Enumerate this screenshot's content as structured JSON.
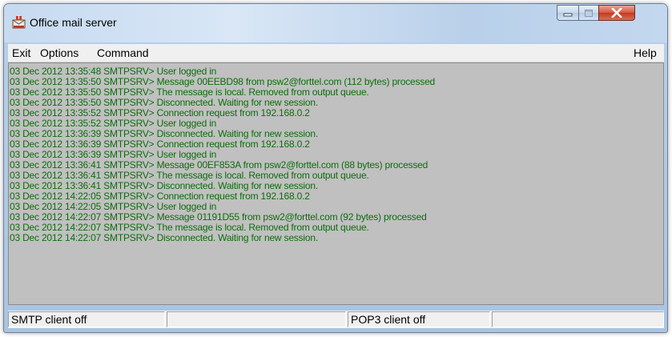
{
  "window": {
    "title": "Office mail server"
  },
  "menu": {
    "exit": "Exit",
    "options": "Options",
    "command": "Command",
    "help": "Help"
  },
  "log": [
    "03 Dec 2012 13:35:48 SMTPSRV> User  logged in",
    "03 Dec 2012 13:35:50 SMTPSRV> Message 00EEBD98 from psw2@forttel.com (112 bytes) processed",
    "03 Dec 2012 13:35:50 SMTPSRV> The message is local. Removed from output queue.",
    "03 Dec 2012 13:35:50 SMTPSRV> Disconnected. Waiting for new session.",
    "03 Dec 2012 13:35:52 SMTPSRV> Connection request from 192.168.0.2",
    "03 Dec 2012 13:35:52 SMTPSRV> User  logged in",
    "03 Dec 2012 13:36:39 SMTPSRV> Disconnected. Waiting for new session.",
    "03 Dec 2012 13:36:39 SMTPSRV> Connection request from 192.168.0.2",
    "03 Dec 2012 13:36:39 SMTPSRV> User  logged in",
    "03 Dec 2012 13:36:41 SMTPSRV> Message 00EF853A from psw2@forttel.com (88 bytes) processed",
    "03 Dec 2012 13:36:41 SMTPSRV> The message is local. Removed from output queue.",
    "03 Dec 2012 13:36:41 SMTPSRV> Disconnected. Waiting for new session.",
    "03 Dec 2012 14:22:05 SMTPSRV> Connection request from 192.168.0.2",
    "03 Dec 2012 14:22:05 SMTPSRV> User  logged in",
    "03 Dec 2012 14:22:07 SMTPSRV> Message 01191D55 from psw2@forttel.com (92 bytes) processed",
    "03 Dec 2012 14:22:07 SMTPSRV> The message is local. Removed from output queue.",
    "03 Dec 2012 14:22:07 SMTPSRV> Disconnected. Waiting for new session."
  ],
  "status": {
    "smtp": "SMTP client off",
    "pop3": "POP3 client off"
  },
  "icons": {
    "app": "mail-server-icon",
    "minimize": "minimize-icon",
    "maximize": "maximize-icon",
    "close": "close-icon"
  },
  "colors": {
    "log_text": "#0b6e0b",
    "log_background": "#c0c0c0",
    "close_button": "#c43a1e"
  }
}
